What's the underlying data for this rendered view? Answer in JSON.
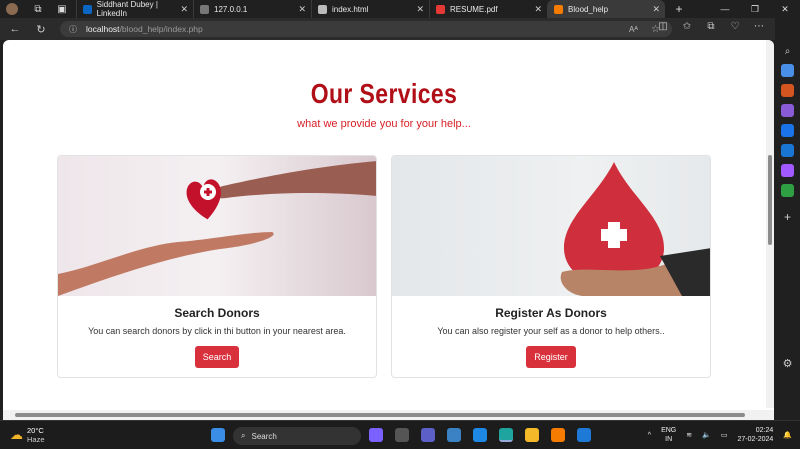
{
  "browser": {
    "tabs": [
      {
        "label": "Siddhant Dubey | LinkedIn",
        "color": "#0a66c2"
      },
      {
        "label": "127.0.0.1",
        "color": "#888888"
      },
      {
        "label": "index.html",
        "color": "#bbbbbb"
      },
      {
        "label": "RESUME.pdf",
        "color": "#e53935"
      },
      {
        "label": "Blood_help",
        "color": "#f57c00"
      }
    ],
    "url_host": "localhost",
    "url_path": "/blood_help/index.php"
  },
  "page": {
    "title": "Our Services",
    "subtitle": "what we provide you for your help...",
    "cards": [
      {
        "title": "Search Donors",
        "text": "You can search donors by click in thi button in your nearest area.",
        "button": "Search"
      },
      {
        "title": "Register As Donors",
        "text": "You can also register your self as a donor to help others..",
        "button": "Register"
      }
    ],
    "accent_color": "#d9313c"
  },
  "taskbar": {
    "temp": "20°C",
    "weather": "Haze",
    "search": "Search",
    "lang1": "ENG",
    "lang2": "IN",
    "time": "02:24",
    "date": "27-02-2024"
  }
}
